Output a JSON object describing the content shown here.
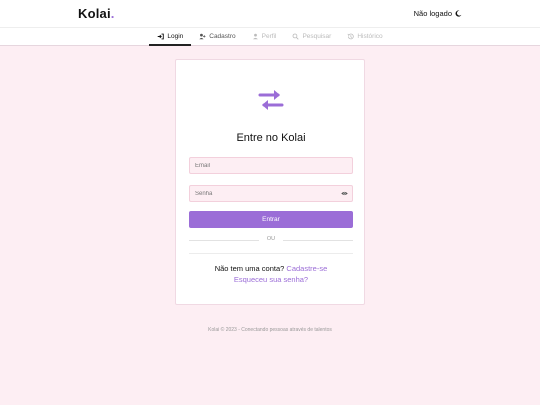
{
  "header": {
    "brand": "Kolai",
    "brand_dot": ".",
    "status": "Não logado",
    "status_icon": "moon-icon"
  },
  "nav": {
    "tabs": [
      {
        "label": "Login",
        "icon": "login-icon",
        "state": "active"
      },
      {
        "label": "Cadastro",
        "icon": "user-plus-icon",
        "state": "enabled"
      },
      {
        "label": "Perfil",
        "icon": "user-icon",
        "state": "disabled"
      },
      {
        "label": "Pesquisar",
        "icon": "search-icon",
        "state": "disabled"
      },
      {
        "label": "Histórico",
        "icon": "history-icon",
        "state": "disabled"
      }
    ]
  },
  "login_card": {
    "logo_icon": "swap-arrows-icon",
    "title": "Entre no Kolai",
    "email_placeholder": "Email",
    "password_placeholder": "Senha",
    "password_toggle_icon": "eye-icon",
    "submit_label": "Entrar",
    "divider_text": "OU",
    "signup_prompt": "Não tem uma conta?",
    "signup_link": "Cadastre-se",
    "forgot_link": "Esqueceu sua senha?"
  },
  "footer": {
    "text": "Kolai © 2023 - Conectando pessoas através de talentos"
  },
  "colors": {
    "accent": "#9b6dd7",
    "background": "#fdeef3",
    "input_background": "#fdeef3"
  }
}
